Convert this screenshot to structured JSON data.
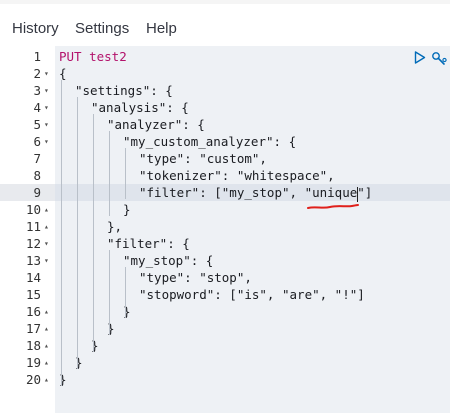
{
  "menu": {
    "items": [
      "History",
      "Settings",
      "Help"
    ]
  },
  "editor": {
    "active_line": 9,
    "lines": [
      {
        "n": "1",
        "fold": "",
        "text": "PUT test2"
      },
      {
        "n": "2",
        "fold": "▾",
        "text": "{"
      },
      {
        "n": "3",
        "fold": "▾",
        "text": "\"settings\": {"
      },
      {
        "n": "4",
        "fold": "▾",
        "text": "\"analysis\": {"
      },
      {
        "n": "5",
        "fold": "▾",
        "text": "\"analyzer\": {"
      },
      {
        "n": "6",
        "fold": "▾",
        "text": "\"my_custom_analyzer\": {"
      },
      {
        "n": "7",
        "fold": "",
        "text": "\"type\": \"custom\","
      },
      {
        "n": "8",
        "fold": "",
        "text": "\"tokenizer\": \"whitespace\","
      },
      {
        "n": "9",
        "fold": "",
        "text": "\"filter\": [\"my_stop\", \"unique\"]"
      },
      {
        "n": "10",
        "fold": "▴",
        "text": "}"
      },
      {
        "n": "11",
        "fold": "▴",
        "text": "},"
      },
      {
        "n": "12",
        "fold": "▾",
        "text": "\"filter\": {"
      },
      {
        "n": "13",
        "fold": "▾",
        "text": "\"my_stop\": {"
      },
      {
        "n": "14",
        "fold": "",
        "text": "\"type\": \"stop\","
      },
      {
        "n": "15",
        "fold": "",
        "text": "\"stopword\": [\"is\", \"are\", \"!\"]"
      },
      {
        "n": "16",
        "fold": "▴",
        "text": "}"
      },
      {
        "n": "17",
        "fold": "▴",
        "text": "}"
      },
      {
        "n": "18",
        "fold": "▴",
        "text": "}"
      },
      {
        "n": "19",
        "fold": "▴",
        "text": "}"
      },
      {
        "n": "20",
        "fold": "▴",
        "text": "}"
      }
    ]
  },
  "toolbar": {
    "run_icon": "play-icon",
    "settings_icon": "wrench-icon",
    "accent": "#006bb8"
  },
  "annotation": {
    "color": "#e0201b",
    "icon": "red-underline-scribble"
  }
}
